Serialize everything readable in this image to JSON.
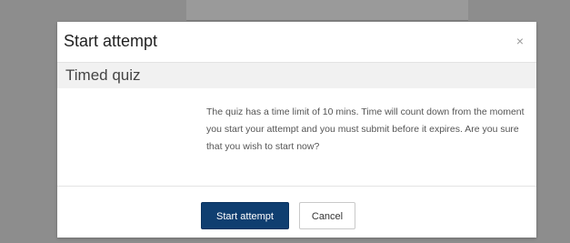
{
  "dialog": {
    "title": "Start attempt",
    "close_icon": "close-icon",
    "close_glyph": "×",
    "subtitle": "Timed quiz",
    "message": "The quiz has a time limit of 10 mins. Time will count down from the moment you start your attempt and you must submit before it expires. Are you sure that you wish to start now?",
    "primary_button_label": "Start attempt",
    "cancel_button_label": "Cancel"
  },
  "colors": {
    "overlay": "#8d8d8d",
    "primary_button": "#0f3e70",
    "subheader_background": "#f1f1f1"
  }
}
